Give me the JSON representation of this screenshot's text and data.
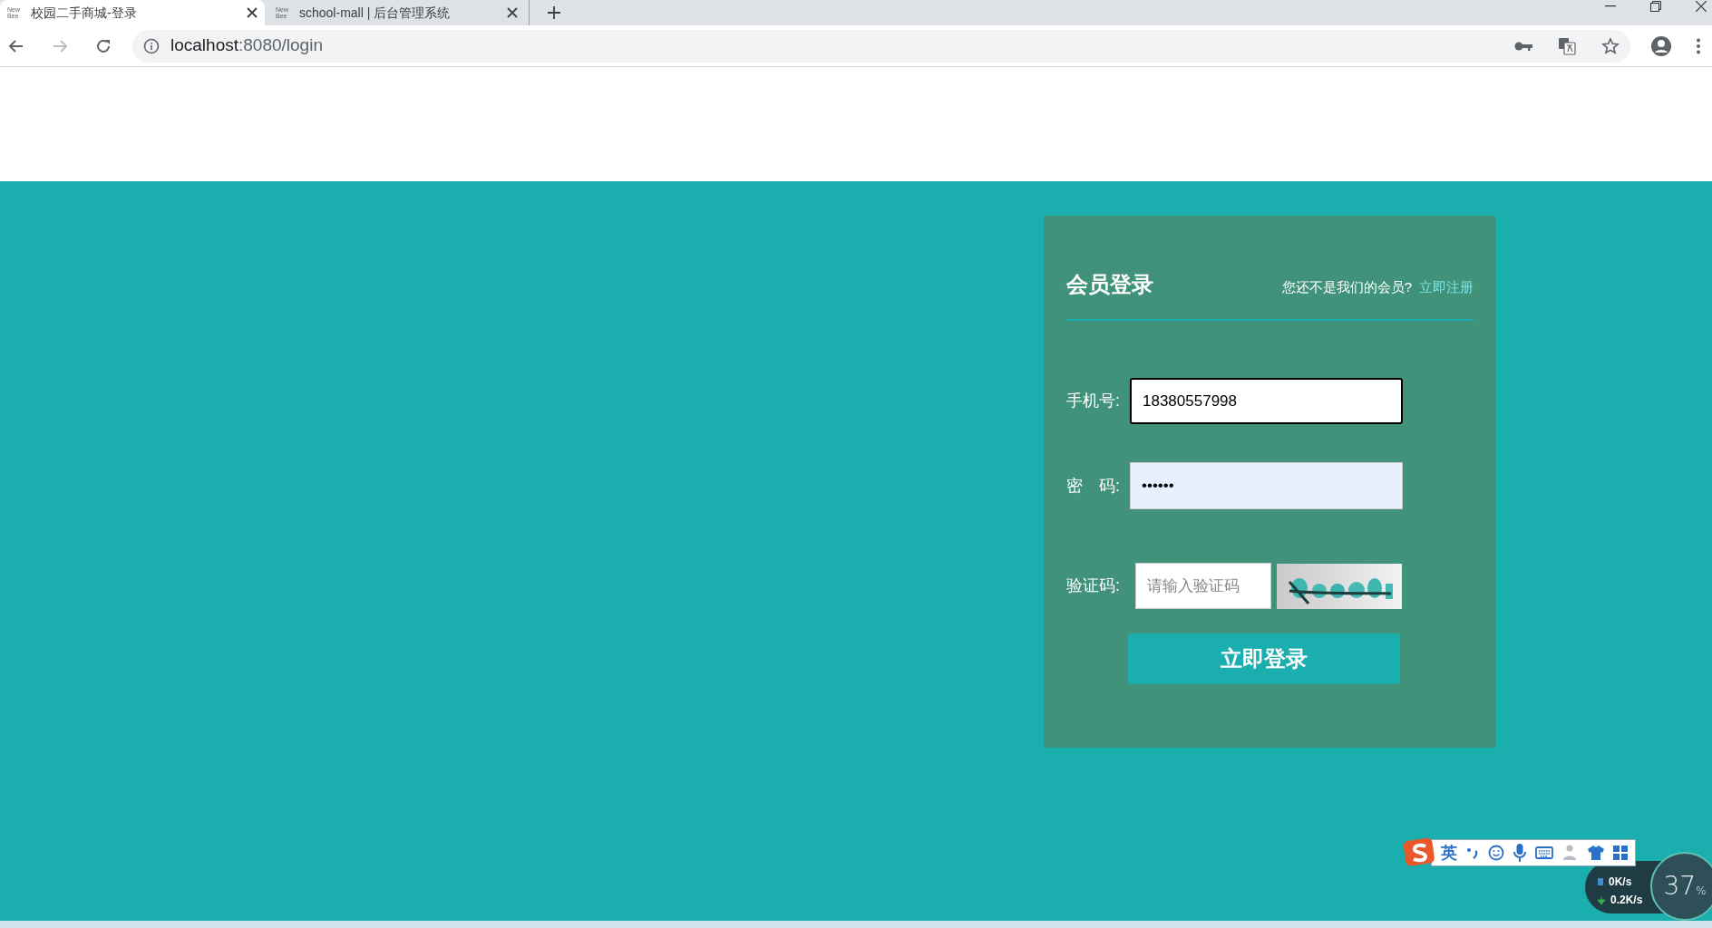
{
  "browser": {
    "tabs": [
      {
        "favicon_lines": [
          "New",
          "Bee"
        ],
        "title": "校园二手商城-登录",
        "selected": true
      },
      {
        "favicon_lines": [
          "New",
          "Bee"
        ],
        "title": "school-mall | 后台管理系统",
        "selected": false
      }
    ],
    "url_host": "localhost",
    "url_rest": ":8080/login"
  },
  "login": {
    "title": "会员登录",
    "prompt": "您还不是我们的会员?",
    "register_link": "立即注册",
    "fields": [
      {
        "kind": "text",
        "label": "手机号:",
        "value": "18380557998",
        "focused": true
      },
      {
        "kind": "password",
        "label": "密　码:",
        "value": "••••••",
        "focused": false
      },
      {
        "kind": "captcha",
        "label": "验证码:",
        "placeholder": "请输入验证码"
      }
    ],
    "submit": "立即登录"
  },
  "ime_toolbar": {
    "mode": "英"
  },
  "net_monitor": {
    "upload": "0K/s",
    "download": "0.2K/s",
    "percent": "37",
    "percent_sign": "%"
  }
}
